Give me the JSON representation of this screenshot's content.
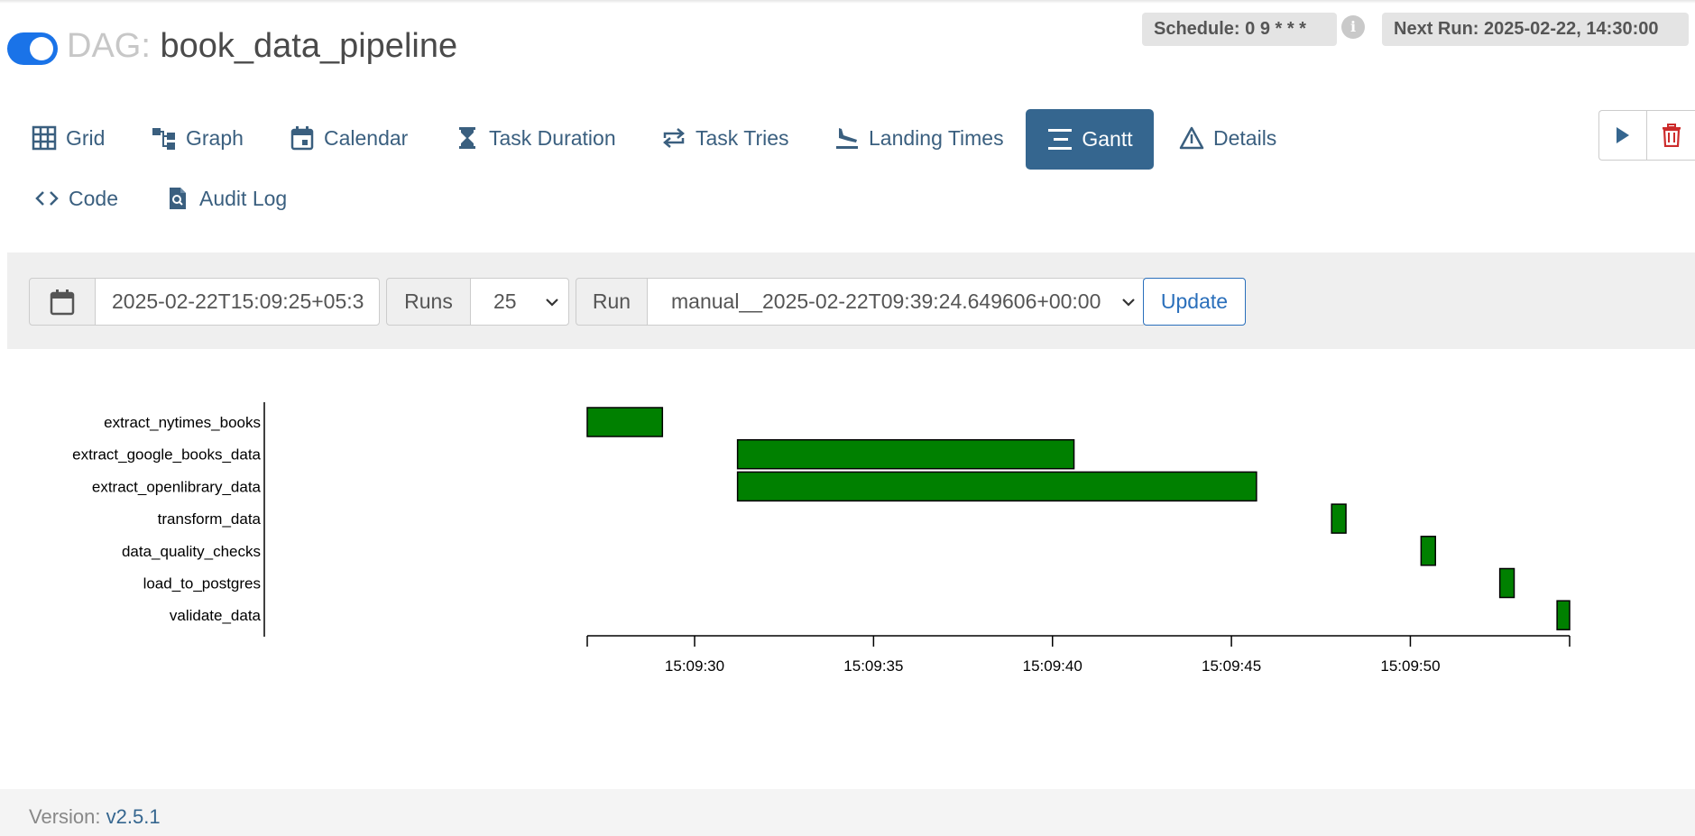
{
  "header": {
    "dag_prefix": "DAG:",
    "dag_name": "book_data_pipeline",
    "schedule": "Schedule: 0 9 * * *",
    "next_run": "Next Run: 2025-02-22, 14:30:00",
    "info_glyph": "i",
    "toggle_on": true
  },
  "nav": {
    "items": [
      {
        "label": "Grid",
        "icon": "grid-icon"
      },
      {
        "label": "Graph",
        "icon": "graph-icon"
      },
      {
        "label": "Calendar",
        "icon": "calendar-icon"
      },
      {
        "label": "Task Duration",
        "icon": "hourglass-icon"
      },
      {
        "label": "Task Tries",
        "icon": "repeat-icon"
      },
      {
        "label": "Landing Times",
        "icon": "plane-landing-icon"
      },
      {
        "label": "Gantt",
        "icon": "gantt-icon",
        "active": true
      },
      {
        "label": "Details",
        "icon": "warning-triangle-icon"
      },
      {
        "label": "Code",
        "icon": "code-icon"
      },
      {
        "label": "Audit Log",
        "icon": "file-search-icon"
      }
    ],
    "actions": [
      {
        "icon": "play-icon"
      },
      {
        "icon": "trash-icon"
      }
    ]
  },
  "filters": {
    "date_value": "2025-02-22T15:09:25+05:3",
    "runs_label": "Runs",
    "runs_value": "25",
    "run_label": "Run",
    "run_value": "manual__2025-02-22T09:39:24.649606+00:00",
    "update_label": "Update"
  },
  "chart_data": {
    "type": "gantt",
    "bar_color": "#008000",
    "tasks": [
      {
        "name": "extract_nytimes_books",
        "start": "15:09:27.0",
        "end": "15:09:29.1"
      },
      {
        "name": "extract_google_books_data",
        "start": "15:09:31.2",
        "end": "15:09:40.6"
      },
      {
        "name": "extract_openlibrary_data",
        "start": "15:09:31.2",
        "end": "15:09:45.7"
      },
      {
        "name": "transform_data",
        "start": "15:09:47.8",
        "end": "15:09:48.2"
      },
      {
        "name": "data_quality_checks",
        "start": "15:09:50.3",
        "end": "15:09:50.7"
      },
      {
        "name": "load_to_postgres",
        "start": "15:09:52.5",
        "end": "15:09:52.9"
      },
      {
        "name": "validate_data",
        "start": "15:09:54.1",
        "end": "15:09:54.45"
      }
    ],
    "x_ticks": [
      "15:09:30",
      "15:09:35",
      "15:09:40",
      "15:09:45",
      "15:09:50"
    ],
    "x_range": [
      "15:09:27.0",
      "15:09:54.45"
    ]
  },
  "footer": {
    "version_label": "Version:",
    "version_value": "v2.5.1"
  }
}
